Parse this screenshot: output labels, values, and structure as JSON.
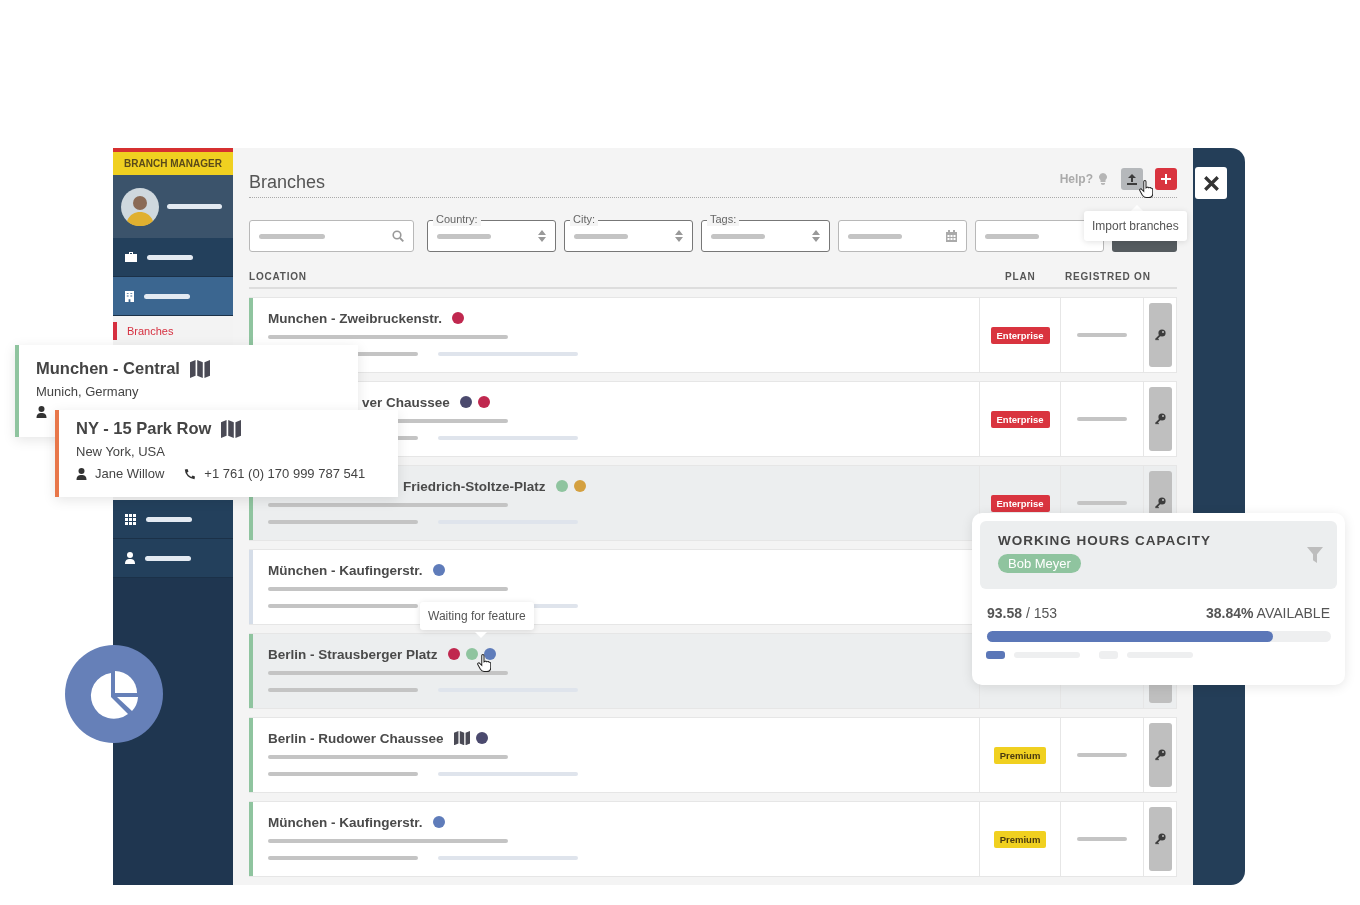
{
  "sidebar": {
    "title": "BRANCH MANAGER",
    "menu": [
      {
        "selected": false
      },
      {
        "selected": true
      }
    ],
    "submenu": [
      {
        "label": "Branches",
        "selected": true
      }
    ],
    "menu_lower": [
      {
        "selected": false
      },
      {
        "selected": false
      }
    ]
  },
  "header": {
    "title": "Branches",
    "help": "Help?",
    "tooltip": "Import branches"
  },
  "filters": [
    {
      "kind": "search"
    },
    {
      "kind": "select",
      "label": "Country:"
    },
    {
      "kind": "select",
      "label": "City:"
    },
    {
      "kind": "select",
      "label": "Tags:"
    },
    {
      "kind": "date"
    },
    {
      "kind": "text"
    },
    {
      "kind": "button"
    }
  ],
  "columns": [
    "LOCATION",
    "PLAN",
    "REGISTRED ON"
  ],
  "rows": [
    {
      "title": "Munchen - Zweibruckenstr.",
      "map": false,
      "color": "#8fc49f",
      "highlighted": false,
      "dots": [
        {
          "color": "#c0284f"
        }
      ],
      "plan": {
        "label": "Enterprise",
        "kind": "enterprise"
      },
      "key": true
    },
    {
      "title": "ver Chaussee",
      "covered": true,
      "map": false,
      "highlighted": false,
      "dots": [
        {
          "color": "#4b4a6e"
        },
        {
          "color": "#c0284f"
        }
      ],
      "plan": {
        "label": "Enterprise",
        "kind": "enterprise"
      },
      "key": true
    },
    {
      "title": "Friedrich-Stoltze-Platz",
      "covered": true,
      "map": false,
      "color": "#8fc49f",
      "highlighted": true,
      "dots": [
        {
          "color": "#8fc49f"
        },
        {
          "color": "#d4a040"
        }
      ],
      "plan": {
        "label": "Enterprise",
        "kind": "enterprise"
      },
      "key": true
    },
    {
      "title": "München - Kaufingerstr.",
      "map": false,
      "color": "#d5dde8",
      "highlighted": false,
      "dots": [
        {
          "color": "#5f7cba"
        }
      ],
      "key": false
    },
    {
      "title": "Berlin - Strausberger Platz",
      "map": false,
      "color": "#8fc49f",
      "highlighted": true,
      "dots": [
        {
          "color": "#c0284f"
        },
        {
          "color": "#8fc49f"
        },
        {
          "color": "#5f7cba"
        }
      ],
      "tooltip": "Waiting for feature",
      "key": true
    },
    {
      "title": "Berlin - Rudower Chaussee",
      "map": true,
      "color": "#8fc49f",
      "highlighted": false,
      "dots": [
        {
          "color": "#4b4a6e"
        }
      ],
      "plan": {
        "label": "Premium",
        "kind": "premium"
      },
      "key": true
    },
    {
      "title": "München - Kaufingerstr.",
      "map": false,
      "color": "#8fc49f",
      "highlighted": false,
      "dots": [
        {
          "color": "#5f7cba"
        }
      ],
      "plan": {
        "label": "Premium",
        "kind": "premium"
      },
      "key": true
    }
  ],
  "cards": [
    {
      "title": "Munchen - Central",
      "subtitle": "Munich, Germany",
      "color": "#8fc49f",
      "kind": "partial"
    },
    {
      "title": "NY - 15 Park Row",
      "subtitle": "New York, USA",
      "color": "#e8774a",
      "kind": "full",
      "person": "Jane Willow",
      "phone": "+1 761 (0) 170 999 787 541"
    }
  ],
  "capacity": {
    "title": "WORKING HOURS CAPACITY",
    "person": "Bob Meyer",
    "used": "93.58",
    "total": "/ 153",
    "percent": "38.84%",
    "available": "AVAILABLE",
    "level": 0.83
  }
}
